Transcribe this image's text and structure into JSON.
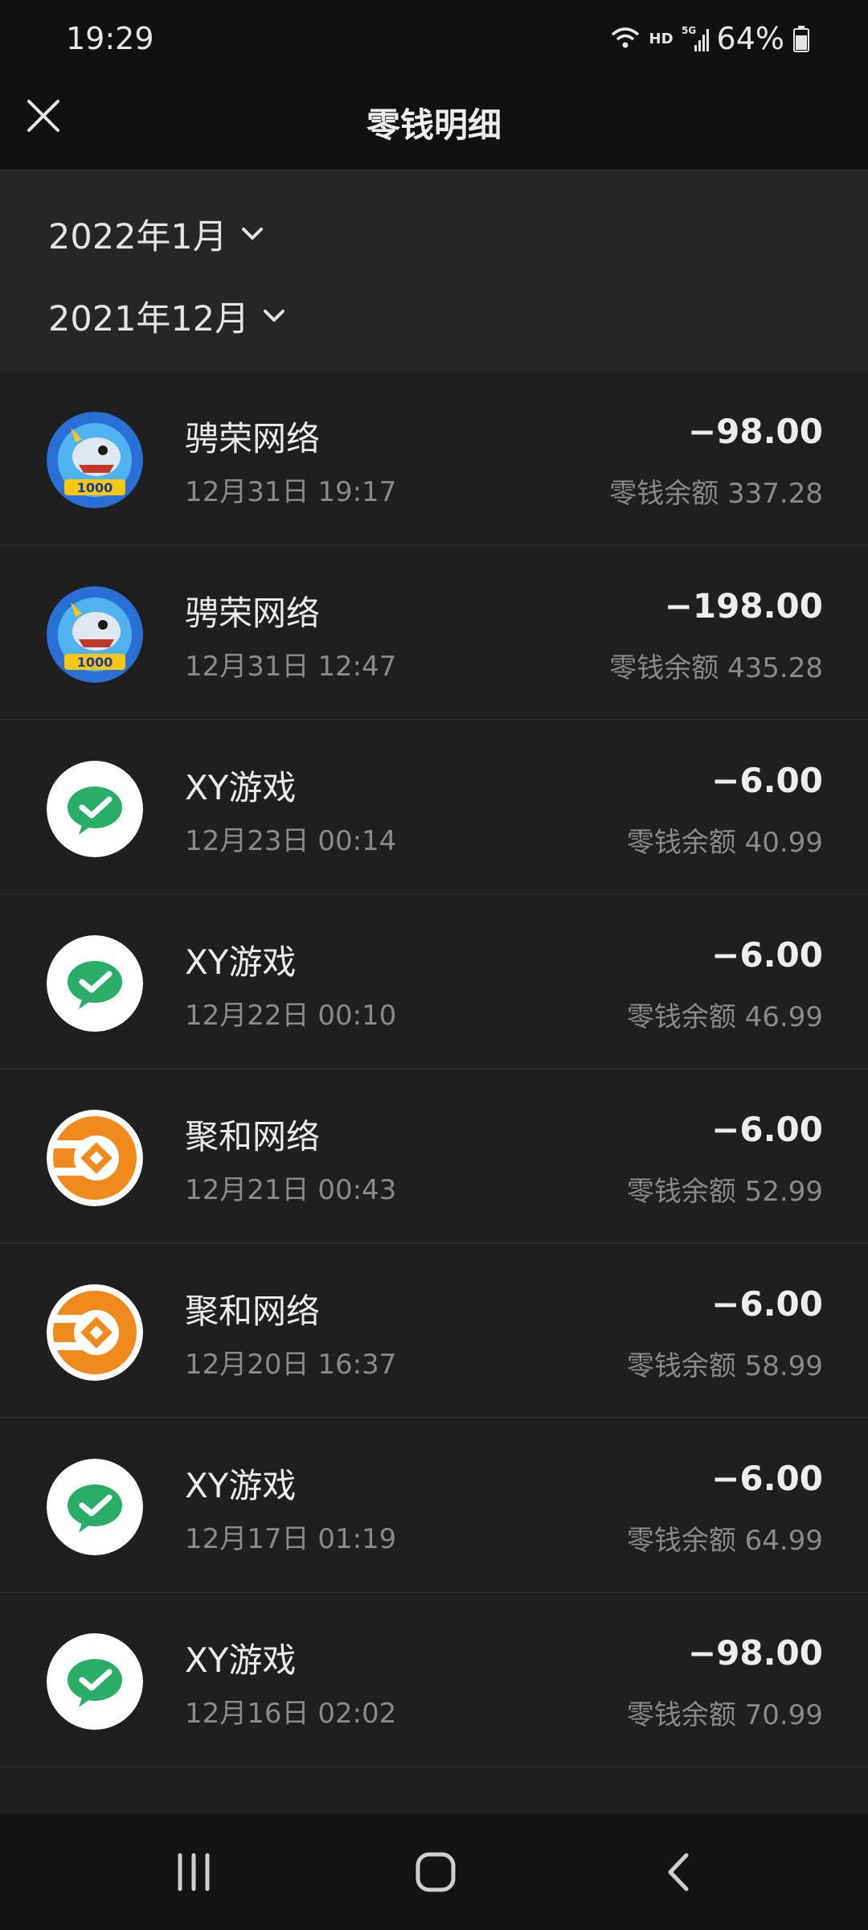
{
  "status": {
    "time": "19:29",
    "network": "HD",
    "battery": "64%",
    "icons": [
      "wifi-icon",
      "signal-5g-icon",
      "battery-icon"
    ]
  },
  "header": {
    "title": "零钱明细",
    "close_icon": "close-icon"
  },
  "months": [
    {
      "label": "2022年1月"
    },
    {
      "label": "2021年12月"
    }
  ],
  "transactions": [
    {
      "merchant": "骋荣网络",
      "time": "12月31日 19:17",
      "amount": "−98.00",
      "balance": "零钱余额 337.28",
      "icon": "game-shark-icon"
    },
    {
      "merchant": "骋荣网络",
      "time": "12月31日 12:47",
      "amount": "−198.00",
      "balance": "零钱余额 435.28",
      "icon": "game-shark-icon"
    },
    {
      "merchant": "XY游戏",
      "time": "12月23日 00:14",
      "amount": "−6.00",
      "balance": "零钱余额 40.99",
      "icon": "wechat-pay-icon"
    },
    {
      "merchant": "XY游戏",
      "time": "12月22日 00:10",
      "amount": "−6.00",
      "balance": "零钱余额 46.99",
      "icon": "wechat-pay-icon"
    },
    {
      "merchant": "聚和网络",
      "time": "12月21日 00:43",
      "amount": "−6.00",
      "balance": "零钱余额 52.99",
      "icon": "orange-coin-icon"
    },
    {
      "merchant": "聚和网络",
      "time": "12月20日 16:37",
      "amount": "−6.00",
      "balance": "零钱余额 58.99",
      "icon": "orange-coin-icon"
    },
    {
      "merchant": "XY游戏",
      "time": "12月17日 01:19",
      "amount": "−6.00",
      "balance": "零钱余额 64.99",
      "icon": "wechat-pay-icon"
    },
    {
      "merchant": "XY游戏",
      "time": "12月16日 02:02",
      "amount": "−98.00",
      "balance": "零钱余额 70.99",
      "icon": "wechat-pay-icon"
    }
  ],
  "colors": {
    "background": "#1f1f1f",
    "header": "#111111",
    "month_section": "#262626",
    "wechat_green": "#2aae67",
    "orange": "#f08a1c"
  },
  "system_nav": [
    "recent-apps-icon",
    "home-icon",
    "back-icon"
  ]
}
